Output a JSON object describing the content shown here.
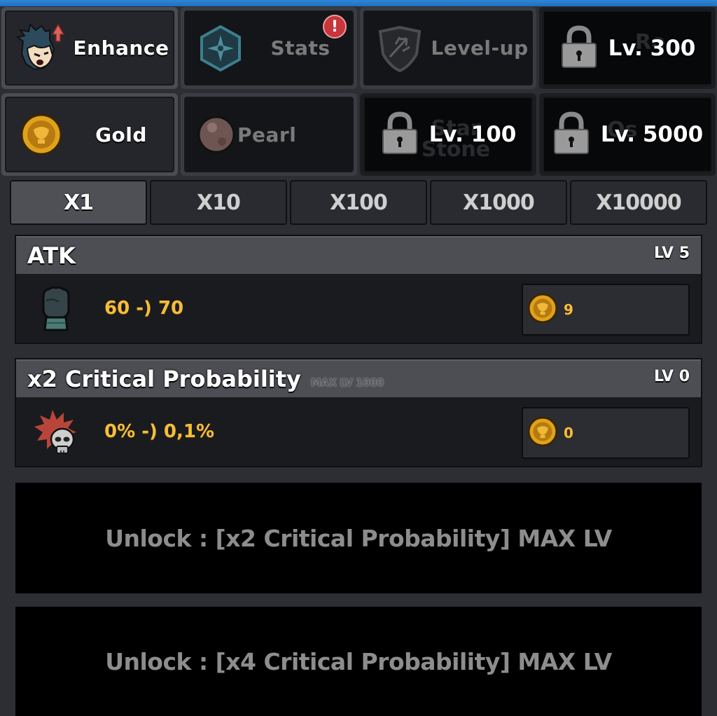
{
  "nav_tabs": [
    {
      "label": "Enhance",
      "icon": "hero-face-upgrade-icon",
      "state": "active"
    },
    {
      "label": "Stats",
      "icon": "hex-star-icon",
      "state": "inactive",
      "badge": "!"
    },
    {
      "label": "Level-up",
      "icon": "trident-shield-icon",
      "state": "inactive"
    },
    {
      "label": "Lv. 300",
      "icon": "lock-icon",
      "state": "locked",
      "hidden_label": "Re"
    }
  ],
  "currency_tabs": [
    {
      "label": "Gold",
      "icon": "gold-coin-icon",
      "state": "active"
    },
    {
      "label": "Pearl",
      "icon": "pearl-icon",
      "state": "inactive"
    },
    {
      "label": "Lv. 100",
      "icon": "lock-icon",
      "state": "locked",
      "hidden_label": "Star Stone"
    },
    {
      "label": "Lv. 5000",
      "icon": "lock-icon",
      "state": "locked",
      "hidden_label": "Os"
    }
  ],
  "multipliers": [
    {
      "label": "X1",
      "active": true
    },
    {
      "label": "X10",
      "active": false
    },
    {
      "label": "X100",
      "active": false
    },
    {
      "label": "X1000",
      "active": false
    },
    {
      "label": "X10000",
      "active": false
    }
  ],
  "upgrades": [
    {
      "title": "ATK",
      "max_level": "",
      "level": "LV 5",
      "value": "60 -) 70",
      "cost": "9",
      "icon": "fist-icon"
    },
    {
      "title": "x2 Critical Probability",
      "max_level": "MAX LV 1000",
      "level": "LV 0",
      "value": "0% -) 0,1%",
      "cost": "0",
      "icon": "critical-skull-icon"
    }
  ],
  "unlock_panels": [
    {
      "text": "Unlock : [x2 Critical Probability] MAX LV"
    },
    {
      "text": "Unlock : [x4 Critical Probability] MAX LV"
    }
  ],
  "colors": {
    "accent_gold": "#f5bd3a",
    "topbar_blue": "#2f86d6",
    "alert_red": "#c8353a"
  }
}
